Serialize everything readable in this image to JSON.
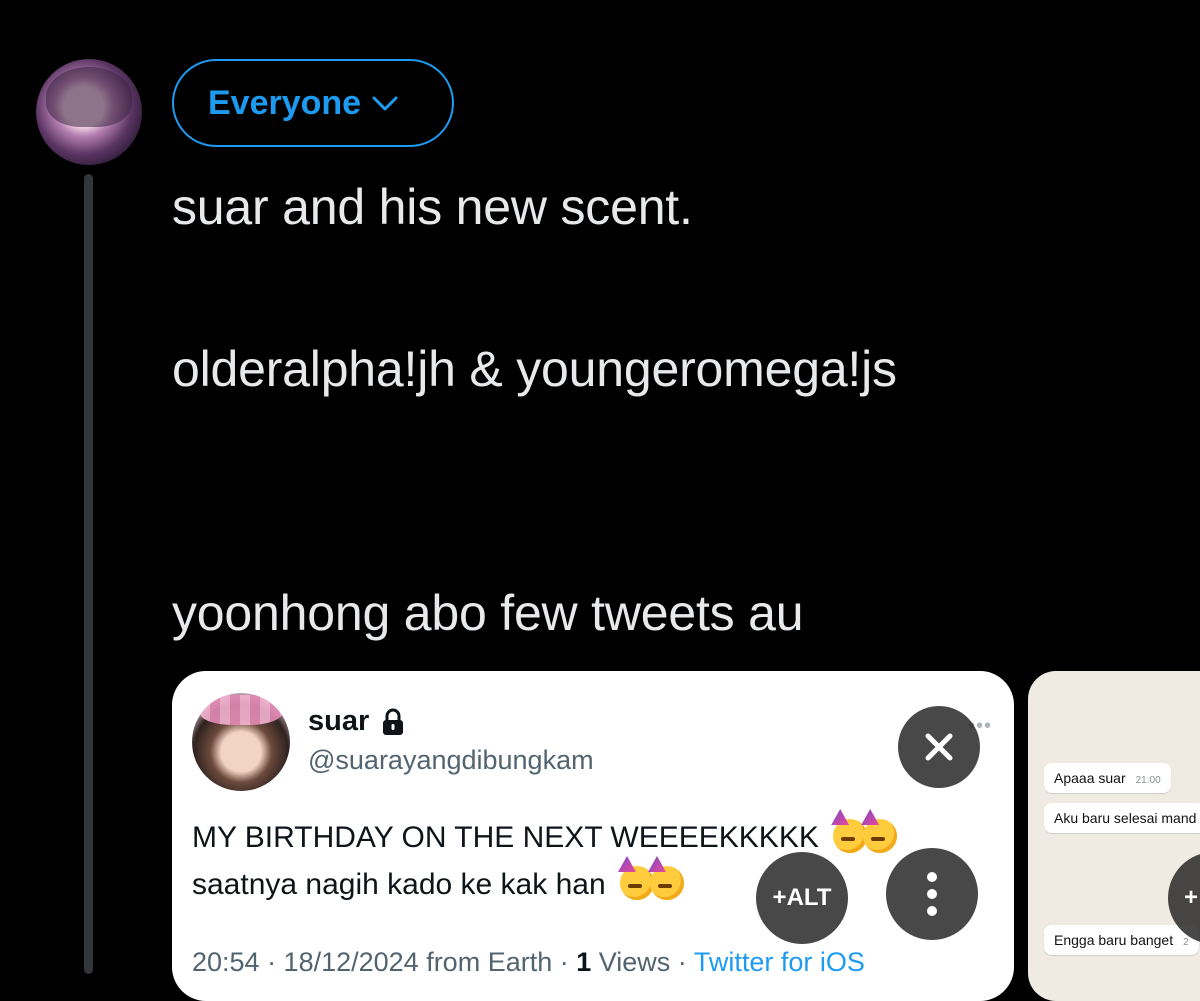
{
  "header": {
    "audience_label": "Everyone"
  },
  "post": {
    "lines": [
      "suar and his new scent.",
      "olderalpha!jh & youngeromega!js",
      "yoonhong abo few tweets au"
    ]
  },
  "media": {
    "card1": {
      "name": "suar",
      "handle": "@suarayangdibungkam",
      "body_line1": "MY BIRTHDAY ON THE NEXT WEEEEKKKKK",
      "body_line2": "saatnya nagih kado ke kak han",
      "meta_time": "20:54 · 18/12/2024 from Earth · ",
      "meta_views_count": "1",
      "meta_views_label": " Views · ",
      "meta_source": "Twitter for iOS"
    },
    "card2": {
      "bubbles": [
        {
          "text": "Apaaa suar",
          "time": "21:00"
        },
        {
          "text": "Aku baru selesai mand",
          "time": ""
        },
        {
          "text": "Engga baru banget",
          "time": "2"
        }
      ]
    },
    "alt_label": "+ALT",
    "peek_label": "+"
  },
  "colors": {
    "accent": "#1d9bf0",
    "background": "#000000",
    "text": "#e7e9ea",
    "secondary": "#536471"
  },
  "icons": [
    "avatar",
    "chevron-down-icon",
    "lock-icon",
    "close-icon",
    "more-vertical-icon",
    "more-horizontal-icon",
    "party-face-emoji"
  ]
}
